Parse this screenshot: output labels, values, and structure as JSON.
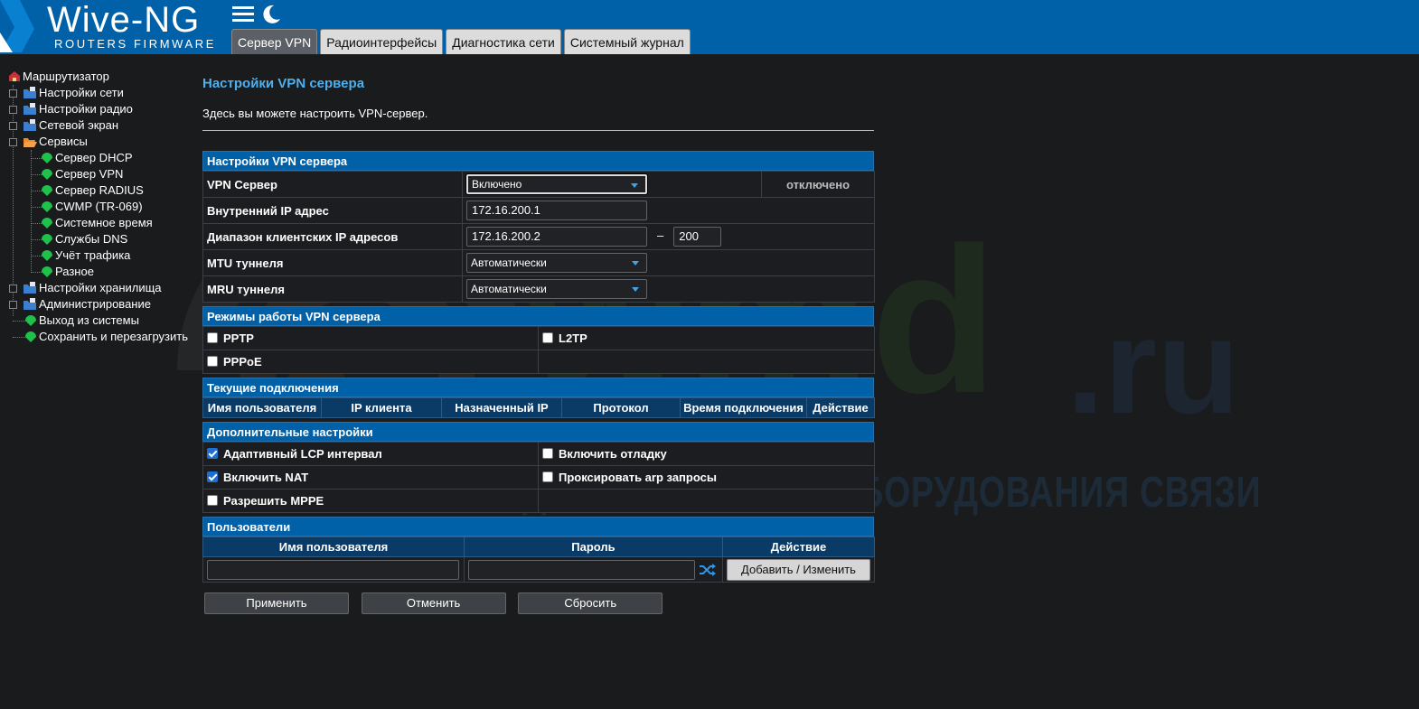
{
  "header": {
    "logo_title": "Wive-NG",
    "logo_subtitle": "ROUTERS FIRMWARE",
    "icons": [
      "menu-icon",
      "moon-icon"
    ],
    "tabs": [
      {
        "label": "Сервер VPN",
        "active": true
      },
      {
        "label": "Радиоинтерфейсы",
        "active": false
      },
      {
        "label": "Диагностика сети",
        "active": false
      },
      {
        "label": "Системный журнал",
        "active": false
      }
    ]
  },
  "sidebar": {
    "root": "Маршрутизатор",
    "items": [
      {
        "label": "Настройки сети"
      },
      {
        "label": "Настройки радио"
      },
      {
        "label": "Сетевой экран"
      },
      {
        "label": "Сервисы"
      },
      {
        "label": "Сервер DHCP"
      },
      {
        "label": "Сервер VPN"
      },
      {
        "label": "Сервер RADIUS"
      },
      {
        "label": "CWMP (TR-069)"
      },
      {
        "label": "Системное время"
      },
      {
        "label": "Службы DNS"
      },
      {
        "label": "Учёт трафика"
      },
      {
        "label": "Разное"
      },
      {
        "label": "Настройки хранилища"
      },
      {
        "label": "Администрирование"
      },
      {
        "label": "Выход из системы"
      },
      {
        "label": "Сохранить и перезагрузить"
      }
    ]
  },
  "watermark": {
    "brand": "wmd",
    "tld": ".ru",
    "tagline": "ДИСТРИБЬЮТОР ОБОРУДОВАНИЯ СВЯЗИ"
  },
  "main": {
    "title": "Настройки VPN сервера",
    "description": "Здесь вы можете настроить VPN-сервер.",
    "settings": {
      "header": "Настройки VPN сервера",
      "vpn_server_label": "VPN Сервер",
      "vpn_server_value": "Включено",
      "vpn_server_status": "отключено",
      "internal_ip_label": "Внутренний IP адрес",
      "internal_ip_value": "172.16.200.1",
      "client_range_label": "Диапазон клиентских IP адресов",
      "client_range_start": "172.16.200.2",
      "range_dash": "–",
      "client_range_end": "200",
      "mtu_label": "MTU туннеля",
      "mtu_value": "Автоматически",
      "mru_label": "MRU туннеля",
      "mru_value": "Автоматически"
    },
    "modes": {
      "header": "Режимы работы VPN сервера",
      "pptp": "PPTP",
      "l2tp": "L2TP",
      "pppoe": "PPPoE"
    },
    "connections": {
      "header": "Текущие подключения",
      "columns": [
        "Имя пользователя",
        "IP клиента",
        "Назначенный IP",
        "Протокол",
        "Время подключения",
        "Действие"
      ]
    },
    "advanced": {
      "header": "Дополнительные настройки",
      "adaptive_lcp": "Адаптивный LCP интервал",
      "adaptive_lcp_checked": true,
      "debug": "Включить отладку",
      "debug_checked": false,
      "nat": "Включить NAT",
      "nat_checked": true,
      "proxy_arp": "Проксировать arp запросы",
      "proxy_arp_checked": false,
      "mppe": "Разрешить MPPE",
      "mppe_checked": false
    },
    "users": {
      "header": "Пользователи",
      "col_username": "Имя пользователя",
      "col_password": "Пароль",
      "col_action": "Действие",
      "username_value": "",
      "password_value": "",
      "add_button": "Добавить / Изменить"
    },
    "buttons": {
      "apply": "Применить",
      "cancel": "Отменить",
      "reset": "Сбросить"
    }
  }
}
